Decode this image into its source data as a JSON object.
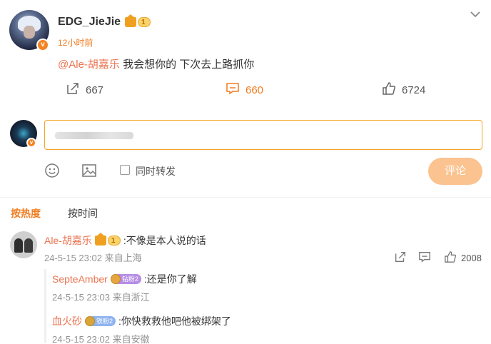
{
  "post": {
    "username": "EDG_JieJie",
    "level": "1",
    "verified_badge": "v",
    "timestamp": "12小时前",
    "mention": "@Ale-胡嘉乐",
    "text": " 我会想你的 下次去上路抓你",
    "icons": {
      "menu": "chevron-down-icon",
      "repost": "share-icon",
      "comment": "comment-icon",
      "like": "thumbs-up-icon"
    },
    "actions": {
      "repost_count": "667",
      "comment_count": "660",
      "like_count": "6724"
    }
  },
  "composer": {
    "placeholder": "",
    "repost_label": "同时转发",
    "submit_label": "评论",
    "icons": {
      "emoji": "emoji-icon",
      "image": "image-icon"
    }
  },
  "sort": {
    "hot": "按热度",
    "time": "按时间"
  },
  "comments": [
    {
      "name": "Ale-胡嘉乐",
      "level": "1",
      "text": ":不像是本人说的话",
      "meta": "24-5-15 23:02 来自上海",
      "like_count": "2008",
      "replies": [
        {
          "name": "SepteAmber",
          "fan_label": "钻粉2",
          "text": ":还是你了解",
          "meta": "24-5-15 23:03 来自浙江"
        },
        {
          "name": "血火砂",
          "fan_label": "铁粉2",
          "text": ":你快救救他吧他被绑架了",
          "meta": "24-5-15 23:02 来自安徽"
        }
      ]
    }
  ],
  "colors": {
    "accent": "#f17c20",
    "name": "#eb7350",
    "submit_bg": "#fbc390",
    "composer_border": "#f5a623"
  }
}
